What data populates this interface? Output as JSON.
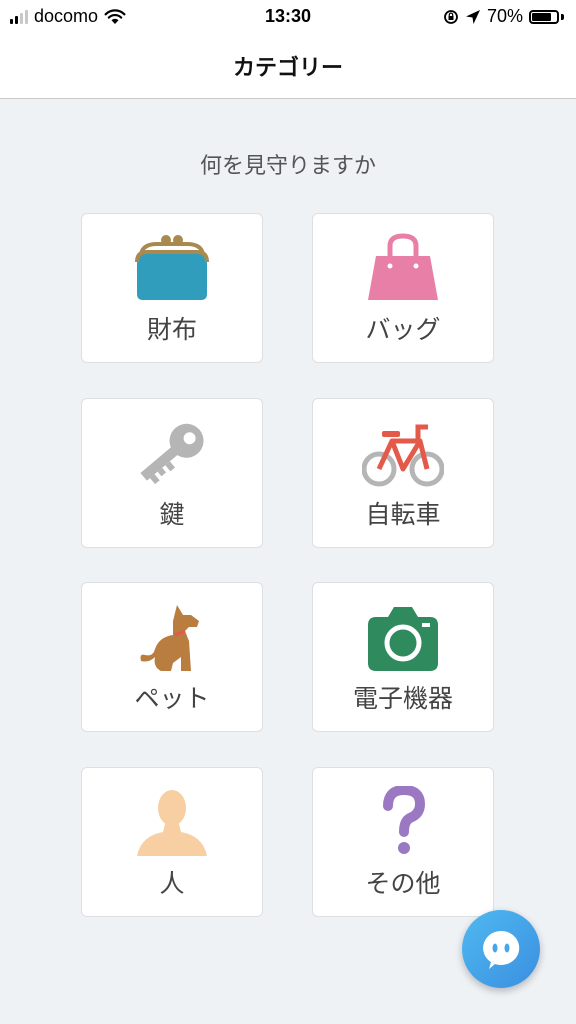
{
  "status_bar": {
    "carrier": "docomo",
    "time": "13:30",
    "battery": "70%",
    "icons": [
      "signal-icon",
      "wifi-icon",
      "rotation-lock-icon",
      "location-icon",
      "battery-icon"
    ]
  },
  "header": {
    "title": "カテゴリー"
  },
  "main": {
    "question": "何を見守りますか",
    "categories": [
      {
        "label": "財布",
        "icon": "wallet-icon",
        "color": "#2f9dbb"
      },
      {
        "label": "バッグ",
        "icon": "bag-icon",
        "color": "#e87fa6"
      },
      {
        "label": "鍵",
        "icon": "key-icon",
        "color": "#b5b5b5"
      },
      {
        "label": "自転車",
        "icon": "bicycle-icon",
        "color": "#e45a4a"
      },
      {
        "label": "ペット",
        "icon": "dog-icon",
        "color": "#b87d3f"
      },
      {
        "label": "電子機器",
        "icon": "camera-icon",
        "color": "#2f8a5e"
      },
      {
        "label": "人",
        "icon": "person-icon",
        "color": "#f7cfa3"
      },
      {
        "label": "その他",
        "icon": "question-icon",
        "color": "#9b79c2"
      }
    ]
  },
  "chat_button": {
    "icon": "chat-icon",
    "color": "#47a6ea"
  }
}
